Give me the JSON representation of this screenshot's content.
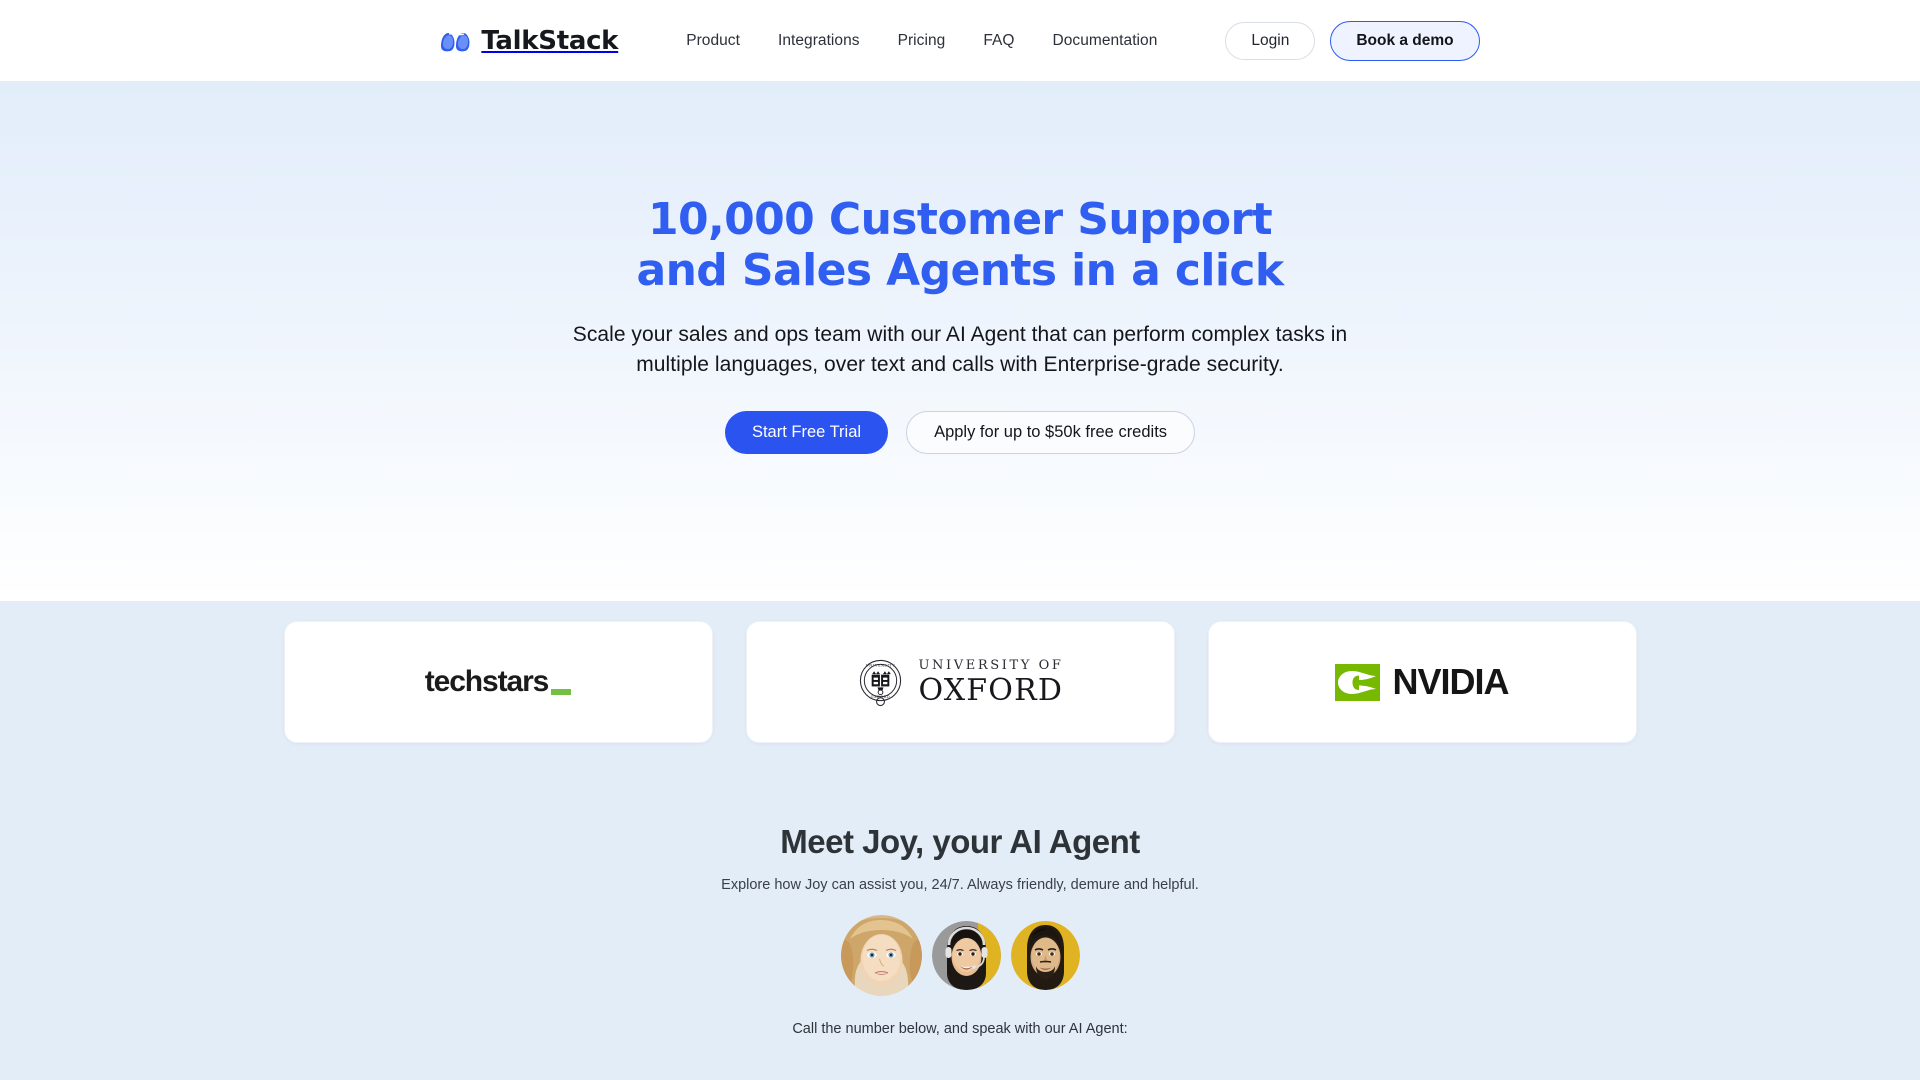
{
  "header": {
    "brand": {
      "name": "TalkStack",
      "logo_icon": "talkstack-wave-logo",
      "color": "#2f5ef0"
    },
    "nav": [
      {
        "label": "Product"
      },
      {
        "label": "Integrations"
      },
      {
        "label": "Pricing"
      },
      {
        "label": "FAQ"
      },
      {
        "label": "Documentation"
      }
    ],
    "login_label": "Login",
    "demo_label": "Book a demo"
  },
  "hero": {
    "headline_line1": "10,000 Customer Support",
    "headline_line2": "and Sales Agents in a click",
    "headline_color": "#2f5ef0",
    "sub_line1": "Scale your sales and ops team with our AI Agent that can perform complex tasks in",
    "sub_line2": "multiple languages, over text and calls with Enterprise-grade security.",
    "cta_primary": "Start Free Trial",
    "cta_primary_color": "#2a53f0",
    "cta_secondary": "Apply for up to $50k free credits"
  },
  "logos": [
    {
      "name": "techstars",
      "text": "techstars",
      "accent_color": "#74c043",
      "icon": "techstars-logo"
    },
    {
      "name": "university-of-oxford",
      "line1": "UNIVERSITY OF",
      "line2": "OXFORD",
      "icon": "oxford-crest-icon"
    },
    {
      "name": "nvidia",
      "text": "NVIDIA",
      "accent_color": "#76b900",
      "icon": "nvidia-eye-logo"
    }
  ],
  "joy": {
    "title": "Meet Joy, your AI Agent",
    "subtitle": "Explore how Joy can assist you, 24/7. Always friendly, demure and helpful.",
    "avatars": [
      {
        "name": "agent-avatar-blonde-woman",
        "selected": true
      },
      {
        "name": "agent-avatar-woman-headset",
        "selected": false
      },
      {
        "name": "agent-avatar-man",
        "selected": false
      }
    ],
    "call_prompt": "Call the number below, and speak with our AI Agent:"
  }
}
